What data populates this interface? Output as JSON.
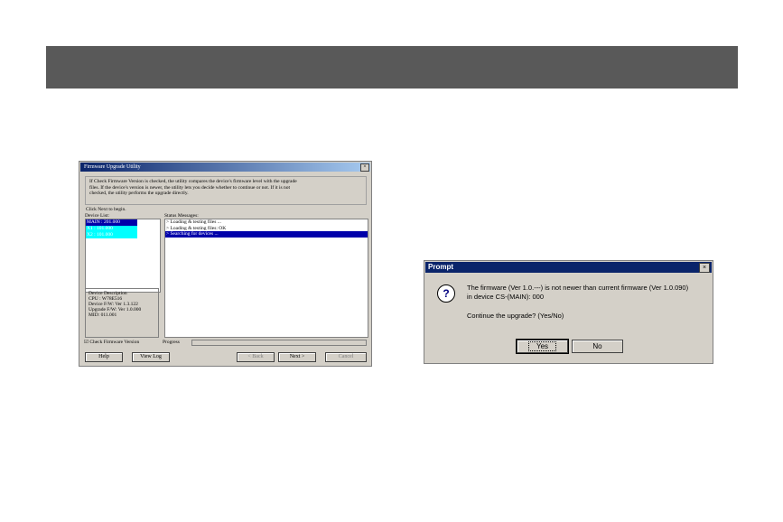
{
  "firmware_window": {
    "title": "Firmware Upgrade Utility",
    "close": "×",
    "intro_line1": "If Check Firmware Version is checked, the utility compares the device's firmware level with the upgrade",
    "intro_line2": "files. If the device's version is newer, the utility lets you decide whether to continue or not. If it is not",
    "intro_line3": "checked, the utility performs the upgrade directly.",
    "begin": "Click Next to begin.",
    "device_list_label": "Device List:",
    "devices": [
      "MAIN : 201.000",
      "X1 : 101.000",
      "X2 : 101.000"
    ],
    "status_label": "Status Messages:",
    "status_messages": [
      "> Loading & testing files ...",
      "> Loading & testing files: OK",
      "> Searching for devices ..."
    ],
    "description_title": "Device Description",
    "description_lines": [
      "CPU : W78E516",
      "Device F/W: Ver 1.3.122",
      "Upgrade F/W: Ver 1.0.000",
      "MID: 011.001"
    ],
    "check_firmware_label": "Check Firmware Version",
    "progress_label": "Progress",
    "buttons": {
      "help": "Help",
      "view_log": "View Log",
      "back": "< Back",
      "next": "Next >",
      "cancel": "Cancel"
    }
  },
  "prompt": {
    "title": "Prompt",
    "close": "×",
    "icon": "question-icon",
    "line1": "The firmware (Ver 1.0.---) is not newer than current firmware (Ver 1.0.090)",
    "line2": "in device CS-(MAIN): 000",
    "line3": "Continue the upgrade? (Yes/No)",
    "yes": "Yes",
    "no": "No"
  },
  "colors": {
    "header_bar": "#595959",
    "title_bar": "#0a246a",
    "selection": "#0000aa",
    "highlight": "#00ffff"
  }
}
